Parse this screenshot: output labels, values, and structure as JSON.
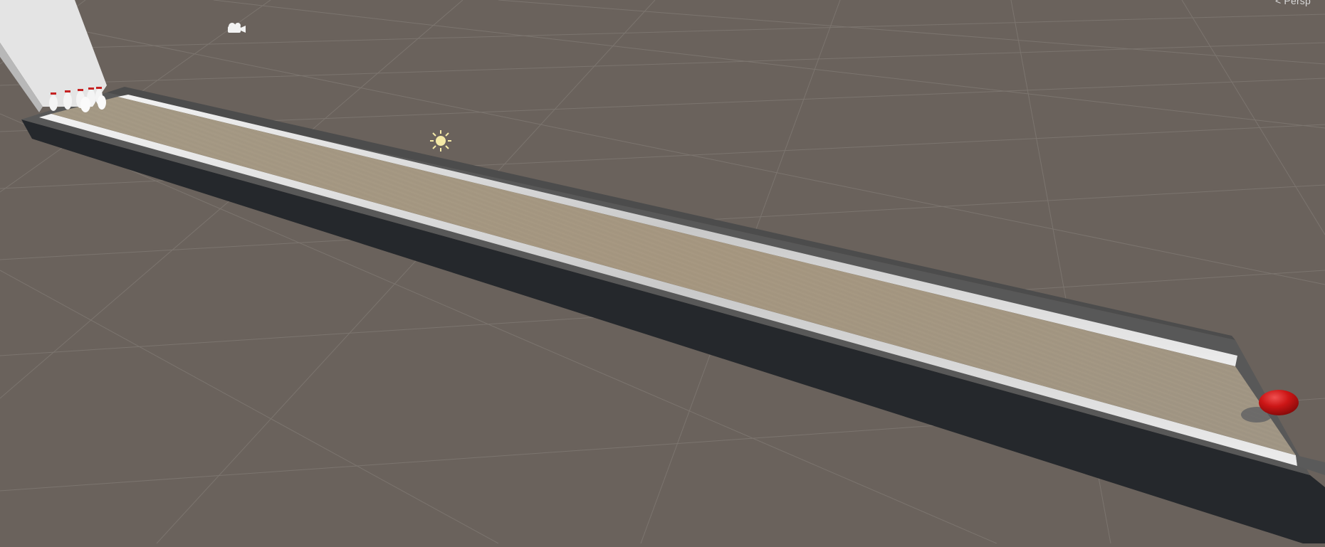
{
  "scene_view": {
    "projection_label": "Persp",
    "gizmos": {
      "camera": "camera-gizmo-icon",
      "light": "directional-light-gizmo-icon"
    },
    "objects": [
      "bowling-lane",
      "bowling-pins",
      "bowling-ball",
      "pin-backstop"
    ],
    "colors": {
      "background": "#6a625c",
      "grid": "#7d7670",
      "lane_wood": "#a89a85",
      "gutter": "#dcdcdc",
      "side_wall": "#25282c",
      "ball": "#cf1a1a"
    }
  }
}
